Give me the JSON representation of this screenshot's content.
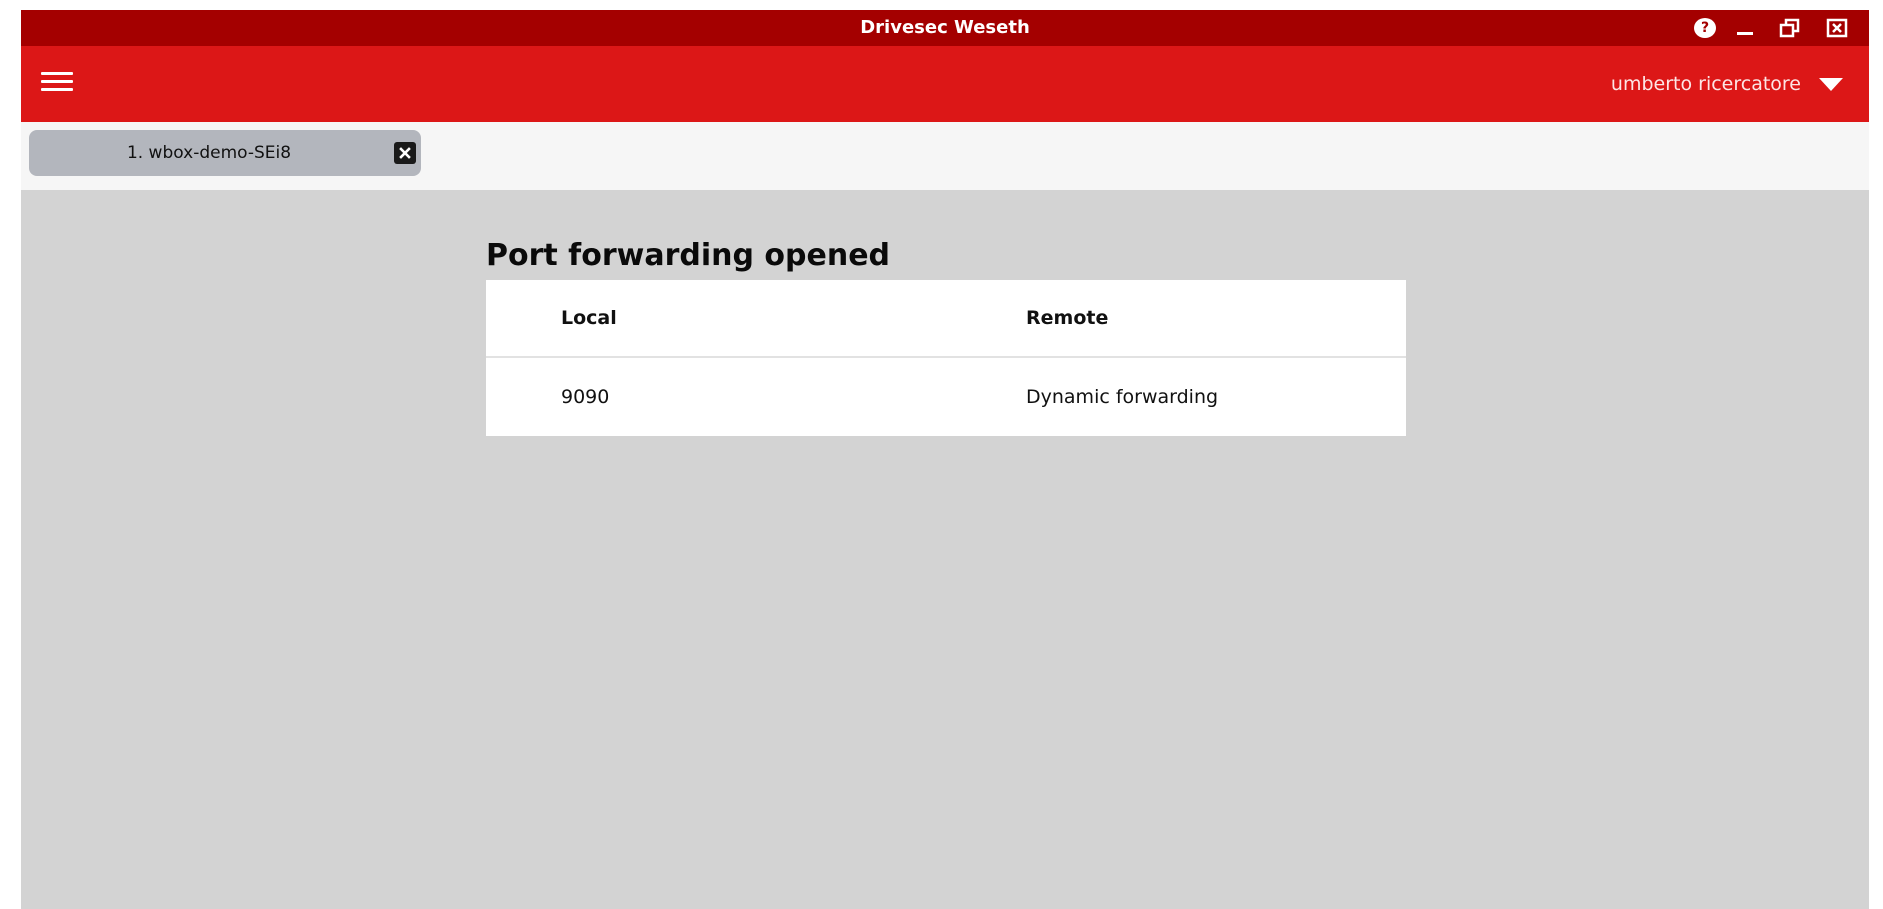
{
  "window": {
    "title": "Drivesec Weseth",
    "controls": {
      "help_glyph": "?",
      "help_icon": "help-circle-icon",
      "minimize_icon": "minimize-icon",
      "maximize_icon": "restore-icon",
      "close_icon": "close-box-icon"
    }
  },
  "header": {
    "menu_icon": "hamburger-menu-icon",
    "user_name": "umberto ricercatore",
    "user_menu_icon": "caret-down-icon"
  },
  "tabs": [
    {
      "label": "1. wbox-demo-SEi8",
      "close_icon": "close-box-icon"
    }
  ],
  "main": {
    "title": "Port forwarding opened",
    "table": {
      "columns": [
        "Local",
        "Remote"
      ],
      "rows": [
        [
          "9090",
          "Dynamic forwarding"
        ]
      ]
    }
  },
  "colors": {
    "titlebar": "#a40000",
    "appbar": "#dc1717",
    "tabstrip": "#f6f6f6",
    "tab": "#b3b6bd",
    "background": "#d3d3d3",
    "table": "#ffffff"
  }
}
